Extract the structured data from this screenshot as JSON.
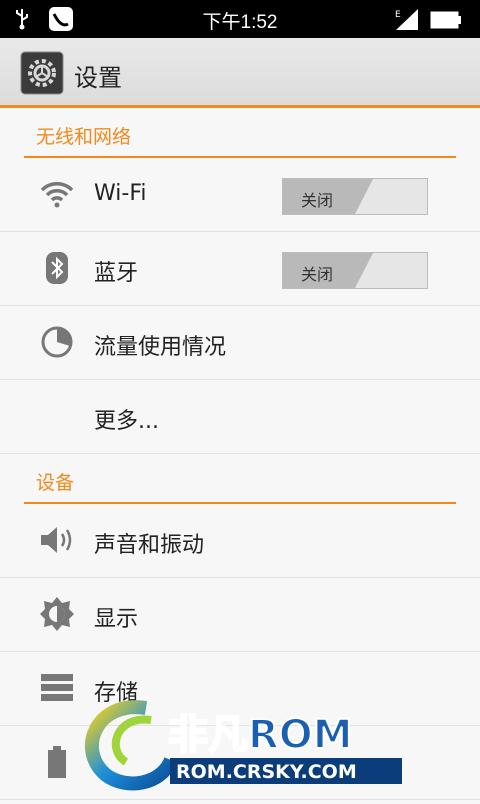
{
  "status_bar": {
    "time": "下午1:52",
    "icons": [
      "usb-icon",
      "notification-icon",
      "signal-icon",
      "battery-icon"
    ]
  },
  "action_bar": {
    "title": "设置",
    "icon": "settings-gear-icon"
  },
  "sections": [
    {
      "header": "无线和网络",
      "items": [
        {
          "label": "Wi-Fi",
          "icon": "wifi-icon",
          "toggle": "关闭"
        },
        {
          "label": "蓝牙",
          "icon": "bluetooth-icon",
          "toggle": "关闭"
        },
        {
          "label": "流量使用情况",
          "icon": "data-usage-icon"
        },
        {
          "label": "更多..."
        }
      ]
    },
    {
      "header": "设备",
      "items": [
        {
          "label": "声音和振动",
          "icon": "speaker-icon"
        },
        {
          "label": "显示",
          "icon": "brightness-icon"
        },
        {
          "label": "存储",
          "icon": "storage-icon"
        },
        {
          "label": "",
          "icon": "battery-icon"
        }
      ]
    }
  ],
  "watermark": {
    "brand": "非凡ROM",
    "url": "ROM.CRSKY.COM"
  },
  "colors": {
    "accent": "#f08a1c",
    "status_bar": "#000000",
    "background": "#f7f7f7"
  }
}
